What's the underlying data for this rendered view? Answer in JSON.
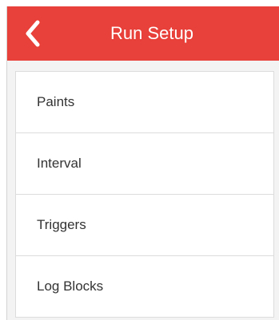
{
  "header": {
    "title": "Run Setup",
    "back_icon": "chevron-left-icon",
    "background_color": "#e8403a"
  },
  "menu": {
    "items": [
      {
        "label": "Paints"
      },
      {
        "label": "Interval"
      },
      {
        "label": "Triggers"
      },
      {
        "label": "Log Blocks"
      }
    ]
  }
}
